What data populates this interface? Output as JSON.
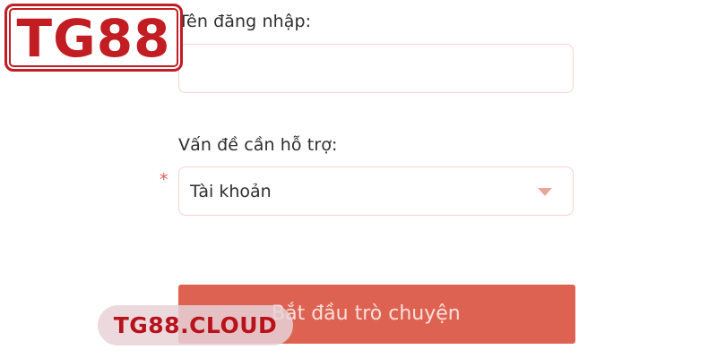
{
  "form": {
    "username_label": "Tên đăng nhập:",
    "username_value": "",
    "issue_label": "Vấn đề cần hỗ trợ:",
    "issue_required_mark": "*",
    "issue_selected": "Tài khoản",
    "start_button_label": "Bắt đầu trò chuyện"
  },
  "watermark": {
    "logo_text": "TG88",
    "site_text": "TG88.CLOUD"
  },
  "icons": {
    "dropdown": "chevron-down-icon"
  },
  "colors": {
    "accent": "#de6252",
    "button_text": "#fbe1dc",
    "field_border": "#f8d4cf",
    "required_star": "#e0604e",
    "brand_red": "#c11d22",
    "watermark_bg": "#e8d2d8"
  }
}
